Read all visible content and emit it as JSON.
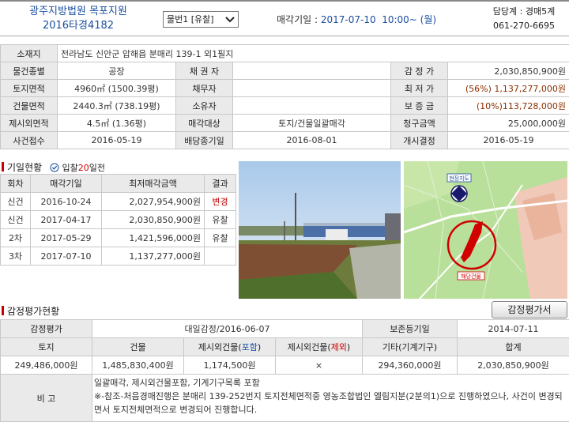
{
  "header": {
    "court_name": "광주지방법원 목포지원",
    "case_number": "2016타경4182",
    "item_select": "물번1 [유찰]",
    "sale_date_label": "매각기일 :",
    "sale_date_value": "2017-07-10  10:00~ (월)",
    "contact_dept": "담당계 : 경매5계",
    "contact_phone": "061-270-6695"
  },
  "property": {
    "location_label": "소재지",
    "location_value": "전라남도 신안군 압해읍 분매리 139-1 외1필지",
    "type_label": "물건종별",
    "type_value": "공장",
    "creditor_label": "채 권 자",
    "creditor_value": "",
    "appraisal_label": "감 정 가",
    "appraisal_value": "2,030,850,900원",
    "land_area_label": "토지면적",
    "land_area_value": "4960㎡ (1500.39평)",
    "debtor_label": "채무자",
    "debtor_value": "",
    "min_price_label": "최 저 가",
    "min_price_value": "(56%) 1,137,277,000원",
    "building_area_label": "건물면적",
    "building_area_value": "2440.3㎡ (738.19평)",
    "owner_label": "소유자",
    "owner_value": "",
    "deposit_label": "보 증 금",
    "deposit_value": "(10%)113,728,000원",
    "excluded_area_label": "제시외면적",
    "excluded_area_value": "4.5㎡ (1.36평)",
    "sale_target_label": "매각대상",
    "sale_target_value": "토지/건물일괄매각",
    "claim_label": "청구금액",
    "claim_value": "25,000,000원",
    "received_label": "사건접수",
    "received_value": "2016-05-19",
    "dividend_label": "배당종기일",
    "dividend_value": "2016-08-01",
    "start_label": "개시결정",
    "start_value": "2016-05-19"
  },
  "history": {
    "title": "기일현황",
    "badge_prefix": "입찰",
    "badge_days": "20",
    "badge_suffix": "일전",
    "headers": [
      "회차",
      "매각기일",
      "최저매각금액",
      "결과"
    ],
    "rows": [
      {
        "round": "신건",
        "date": "2016-10-24",
        "price": "2,027,954,900원",
        "result": "변경",
        "result_color": "#c00000"
      },
      {
        "round": "신건",
        "date": "2017-04-17",
        "price": "2,030,850,900원",
        "result": "유찰",
        "result_color": "#333333"
      },
      {
        "round": "2차",
        "date": "2017-05-29",
        "price": "1,421,596,000원",
        "result": "유찰",
        "result_color": "#333333"
      },
      {
        "round": "3차",
        "date": "2017-07-10",
        "price": "1,137,277,000원",
        "result": "",
        "result_color": "#333333"
      }
    ]
  },
  "appraisal": {
    "title": "감정평가현황",
    "button_label": "감정평가서",
    "agency_label": "감정평가",
    "agency_value": "대일감정/2016-06-07",
    "preserve_label": "보존등기일",
    "preserve_value": "2014-07-11",
    "col_land": "토지",
    "col_building": "건물",
    "col_excl_incl_prefix": "제시외건물(",
    "col_excl_incl_word": "포함",
    "col_excl_excl_prefix": "제시외건물(",
    "col_excl_excl_word": "제외",
    "col_close": ")",
    "col_other": "기타(기계기구)",
    "col_total": "합계",
    "val_land": "249,486,000원",
    "val_building": "1,485,830,400원",
    "val_excl_incl": "1,174,500원",
    "val_excl_excl": "×",
    "val_other": "294,360,000원",
    "val_total": "2,030,850,900원",
    "remark_label": "비 고",
    "remark_line1": "일괄매각, 제시외건물포함, 기계기구목록 포함",
    "remark_line2": "※-참조-처음경매진행은 분매리 139-252번지 토지전체면적중 영농조합법인 엘림지분(2분의1)으로 진행하였으나, 사건이 변경되면서 토지전체면적으로 변경되어 진행합니다."
  },
  "map_labels": {
    "top": "현장지도",
    "bottom": "해당건물"
  },
  "colors": {
    "accent_blue": "#1a4fa0",
    "accent_red": "#c00000",
    "label_bg": "#eaeaea"
  }
}
